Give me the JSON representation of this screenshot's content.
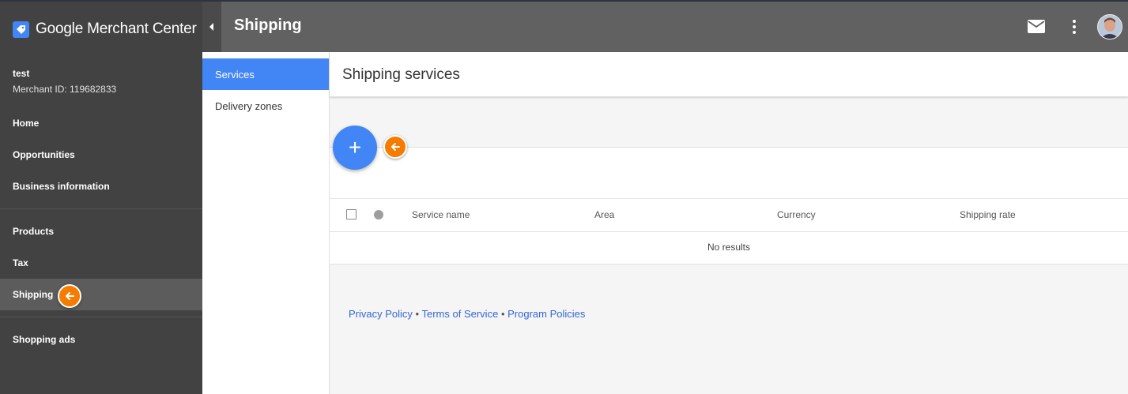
{
  "app": {
    "brand": "Google Merchant Center"
  },
  "account": {
    "name": "test",
    "merchant_id": "Merchant ID: 119682833"
  },
  "nav": {
    "home": "Home",
    "opportunities": "Opportunities",
    "business_information": "Business information",
    "products": "Products",
    "tax": "Tax",
    "shipping": "Shipping",
    "shopping_ads": "Shopping ads"
  },
  "header": {
    "title": "Shipping"
  },
  "subnav": {
    "services": "Services",
    "delivery_zones": "Delivery zones"
  },
  "main": {
    "title": "Shipping services",
    "add_button": "+",
    "table": {
      "columns": [
        "Service name",
        "Area",
        "Currency",
        "Shipping rate"
      ],
      "empty_message": "No results"
    }
  },
  "footer": {
    "privacy": "Privacy Policy",
    "terms": "Terms of Service",
    "program": "Program Policies",
    "separator": "•"
  },
  "icons": {
    "brand_logo": "merchant-tag-icon",
    "collapse": "caret-left-icon",
    "mail": "mail-icon",
    "more": "more-vert-icon",
    "hint": "arrow-left-icon"
  },
  "colors": {
    "accent": "#4285f4",
    "hint": "#f57c00",
    "nav_bg": "#424242",
    "header_bg": "#616161"
  }
}
